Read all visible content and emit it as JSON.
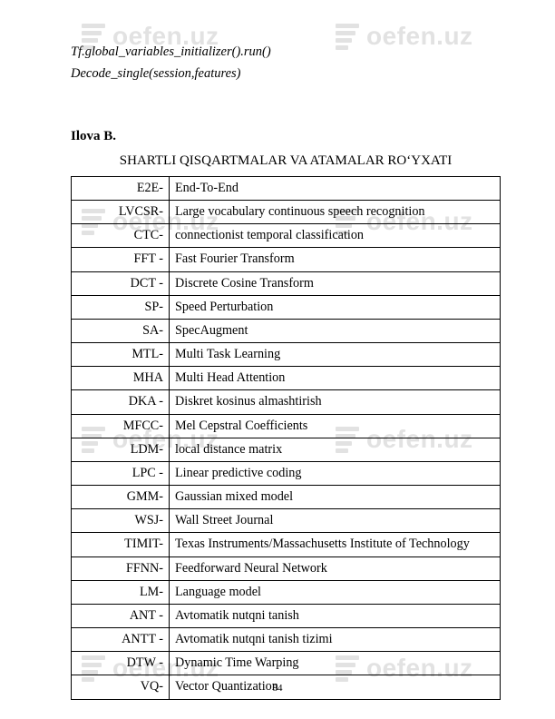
{
  "watermark_text": "oefen.uz",
  "code_lines": [
    "Tf.global_variables_initializer().run()",
    "Decode_single(session,features)"
  ],
  "section_label": "Ilova B.",
  "title": "SHARTLI QISQARTMALAR VA ATAMALAR RO‘YXATI",
  "rows": [
    {
      "abbr": "E2E-",
      "def": "End-To-End"
    },
    {
      "abbr": "LVCSR-",
      "def": "Large vocabulary continuous speech recognition"
    },
    {
      "abbr": "CTC-",
      "def": "connectionist temporal classification"
    },
    {
      "abbr": "FFT -",
      "def": "Fast Fourier Transform"
    },
    {
      "abbr": "DCT -",
      "def": "Discrete Cosine Transform"
    },
    {
      "abbr": "SP-",
      "def": "Speed Perturbation"
    },
    {
      "abbr": "SA-",
      "def": "SpecAugment"
    },
    {
      "abbr": "MTL-",
      "def": "Multi Task Learning"
    },
    {
      "abbr": "MHA",
      "def": "Multi Head Attention"
    },
    {
      "abbr": "DKA -",
      "def": "Diskret kosinus almashtirish"
    },
    {
      "abbr": "MFCC-",
      "def": "Mel Cepstral Coefficients"
    },
    {
      "abbr": "LDM-",
      "def": "local distance matrix"
    },
    {
      "abbr": "LPC -",
      "def": "Linear predictive coding"
    },
    {
      "abbr": "GMM-",
      "def": "Gaussian mixed model"
    },
    {
      "abbr": "WSJ-",
      "def": "Wall Street Journal"
    },
    {
      "abbr": "TIMIT-",
      "def": "Texas Instruments/Massachusetts Institute of Technology"
    },
    {
      "abbr": "FFNN-",
      "def": "Feedforward Neural Network"
    },
    {
      "abbr": "LM-",
      "def": "Language model"
    },
    {
      "abbr": "ANT -",
      "def": "Avtomatik nutqni tanish"
    },
    {
      "abbr": "ANTT -",
      "def": "Avtomatik nutqni tanish tizimi"
    },
    {
      "abbr": "DTW -",
      "def": "Dynamic Time Warping"
    },
    {
      "abbr": "VQ-",
      "def": "Vector Quantization"
    }
  ],
  "page_number": "84"
}
